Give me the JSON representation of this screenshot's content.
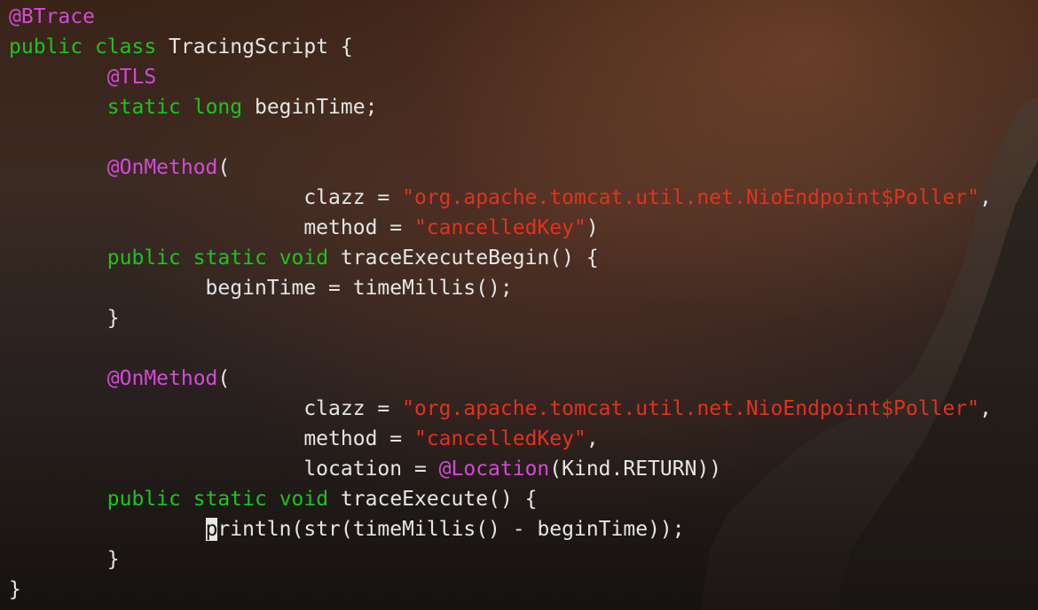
{
  "colors": {
    "annotation": "#d44ad4",
    "keyword": "#1fc21f",
    "string": "#e1321f",
    "text": "#e6e6e6"
  },
  "code": {
    "lines": [
      [
        {
          "t": "ann",
          "v": "@BTrace"
        }
      ],
      [
        {
          "t": "kw",
          "v": "public"
        },
        {
          "t": "txt",
          "v": " "
        },
        {
          "t": "kw",
          "v": "class"
        },
        {
          "t": "txt",
          "v": " TracingScript {"
        }
      ],
      [
        {
          "t": "txt",
          "v": "        "
        },
        {
          "t": "ann",
          "v": "@TLS"
        }
      ],
      [
        {
          "t": "txt",
          "v": "        "
        },
        {
          "t": "kw",
          "v": "static"
        },
        {
          "t": "txt",
          "v": " "
        },
        {
          "t": "kw",
          "v": "long"
        },
        {
          "t": "txt",
          "v": " beginTime;"
        }
      ],
      [
        {
          "t": "txt",
          "v": ""
        }
      ],
      [
        {
          "t": "txt",
          "v": "        "
        },
        {
          "t": "ann",
          "v": "@OnMethod"
        },
        {
          "t": "txt",
          "v": "("
        }
      ],
      [
        {
          "t": "txt",
          "v": "                        clazz = "
        },
        {
          "t": "str",
          "v": "\"org.apache.tomcat.util.net.NioEndpoint$Poller\""
        },
        {
          "t": "txt",
          "v": ","
        }
      ],
      [
        {
          "t": "txt",
          "v": "                        method = "
        },
        {
          "t": "str",
          "v": "\"cancelledKey\""
        },
        {
          "t": "txt",
          "v": ")"
        }
      ],
      [
        {
          "t": "txt",
          "v": "        "
        },
        {
          "t": "kw",
          "v": "public"
        },
        {
          "t": "txt",
          "v": " "
        },
        {
          "t": "kw",
          "v": "static"
        },
        {
          "t": "txt",
          "v": " "
        },
        {
          "t": "kw",
          "v": "void"
        },
        {
          "t": "txt",
          "v": " traceExecuteBegin() {"
        }
      ],
      [
        {
          "t": "txt",
          "v": "                beginTime = timeMillis();"
        }
      ],
      [
        {
          "t": "txt",
          "v": "        }"
        }
      ],
      [
        {
          "t": "txt",
          "v": ""
        }
      ],
      [
        {
          "t": "txt",
          "v": "        "
        },
        {
          "t": "ann",
          "v": "@OnMethod"
        },
        {
          "t": "txt",
          "v": "("
        }
      ],
      [
        {
          "t": "txt",
          "v": "                        clazz = "
        },
        {
          "t": "str",
          "v": "\"org.apache.tomcat.util.net.NioEndpoint$Poller\""
        },
        {
          "t": "txt",
          "v": ","
        }
      ],
      [
        {
          "t": "txt",
          "v": "                        method = "
        },
        {
          "t": "str",
          "v": "\"cancelledKey\""
        },
        {
          "t": "txt",
          "v": ","
        }
      ],
      [
        {
          "t": "txt",
          "v": "                        location = "
        },
        {
          "t": "ann",
          "v": "@Location"
        },
        {
          "t": "txt",
          "v": "(Kind.RETURN))"
        }
      ],
      [
        {
          "t": "txt",
          "v": "        "
        },
        {
          "t": "kw",
          "v": "public"
        },
        {
          "t": "txt",
          "v": " "
        },
        {
          "t": "kw",
          "v": "static"
        },
        {
          "t": "txt",
          "v": " "
        },
        {
          "t": "kw",
          "v": "void"
        },
        {
          "t": "txt",
          "v": " traceExecute() {"
        }
      ],
      [
        {
          "t": "txt",
          "v": "                "
        },
        {
          "t": "cursor",
          "v": "p"
        },
        {
          "t": "txt",
          "v": "rintln(str(timeMillis() - beginTime));"
        }
      ],
      [
        {
          "t": "txt",
          "v": "        }"
        }
      ],
      [
        {
          "t": "txt",
          "v": "}"
        }
      ]
    ]
  }
}
